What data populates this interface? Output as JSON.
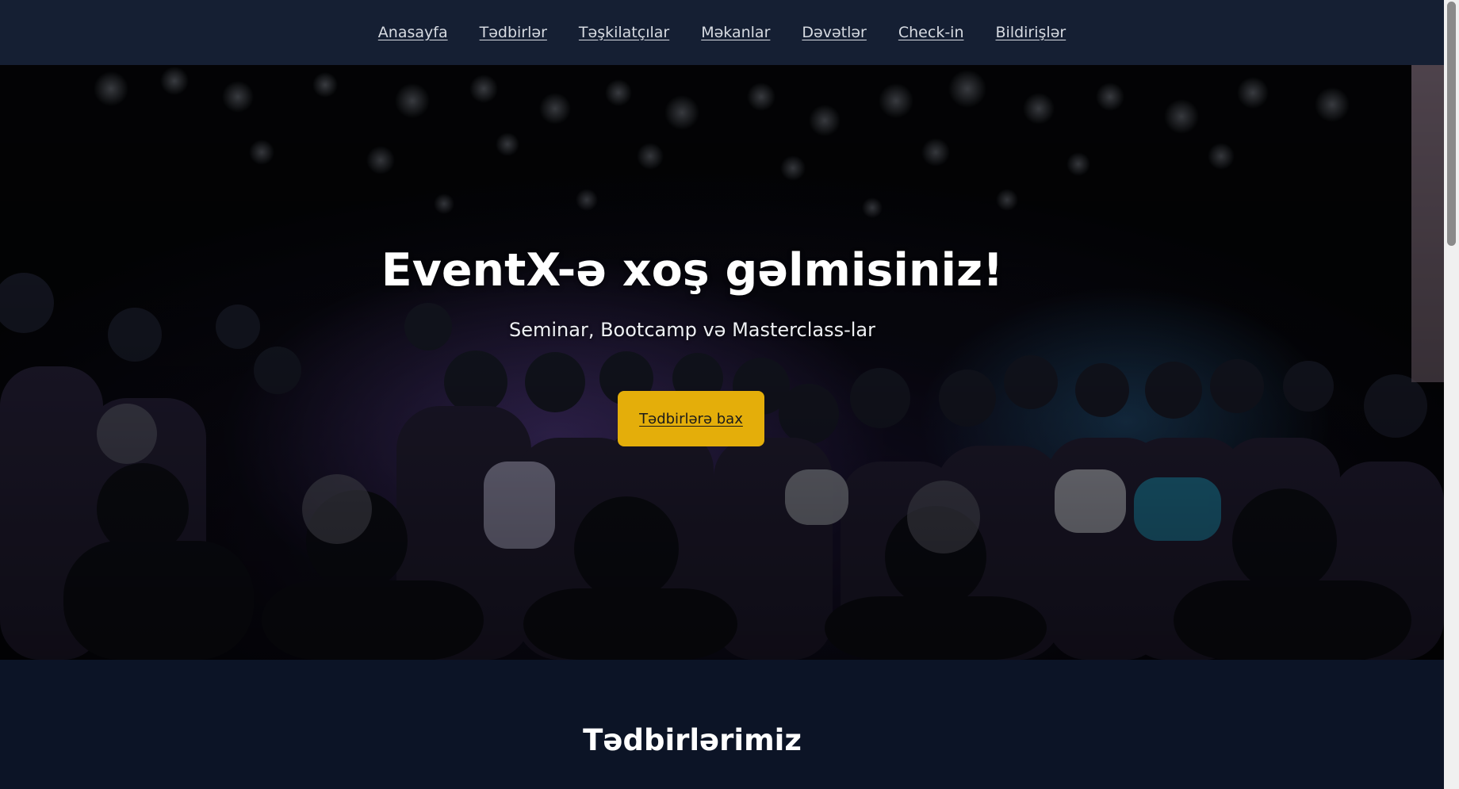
{
  "nav": {
    "items": [
      {
        "label": "Anasayfa"
      },
      {
        "label": "Tədbirlər"
      },
      {
        "label": "Təşkilatçılar"
      },
      {
        "label": "Məkanlar"
      },
      {
        "label": "Dəvətlər"
      },
      {
        "label": "Check-in"
      },
      {
        "label": "Bildirişlər"
      }
    ]
  },
  "hero": {
    "title": "EventX-ə xoş gəlmisiniz!",
    "subtitle": "Seminar, Bootcamp və Masterclass-lar",
    "cta_label": "Tədbirlərə bax",
    "background_image": "conference-audience-photo"
  },
  "section": {
    "title": "Tədbirlərimiz"
  },
  "colors": {
    "nav_bg": "#151f33",
    "page_bg": "#0c1426",
    "cta_bg": "#e4ae0a",
    "nav_text": "#d7dbe2"
  }
}
